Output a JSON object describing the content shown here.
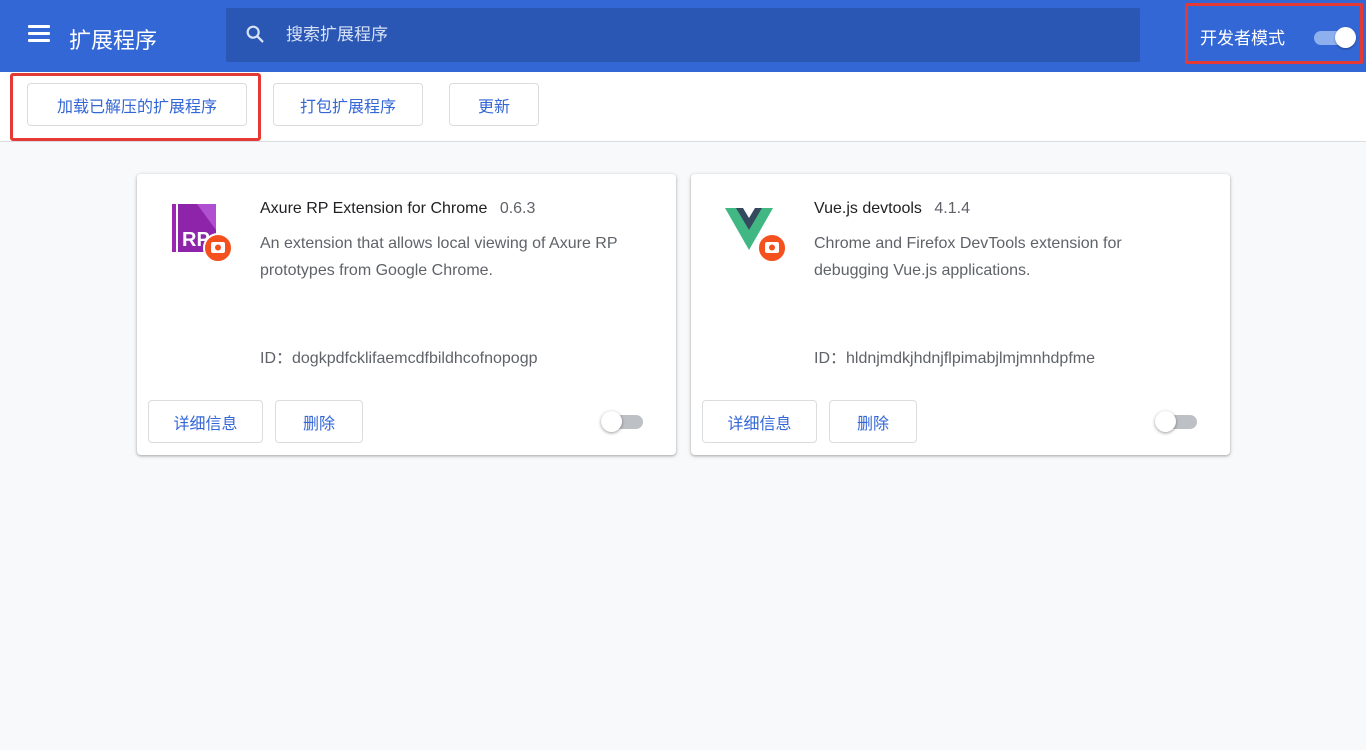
{
  "header": {
    "title": "扩展程序",
    "search_placeholder": "搜索扩展程序",
    "dev_mode_label": "开发者模式",
    "dev_mode_on": true
  },
  "toolbar": {
    "load_unpacked": "加载已解压的扩展程序",
    "pack": "打包扩展程序",
    "update": "更新"
  },
  "extensions": [
    {
      "name": "Axure RP Extension for Chrome",
      "version": "0.6.3",
      "description": "An extension that allows local viewing of Axure RP prototypes from Google Chrome.",
      "id": "ID：dogkpdfcklifaemcdfbildhcofnopogp",
      "details_label": "详细信息",
      "remove_label": "删除",
      "enabled": false,
      "icon": "axure-rp-icon",
      "icon_text": "RP"
    },
    {
      "name": "Vue.js devtools",
      "version": "4.1.4",
      "description": "Chrome and Firefox DevTools extension for debugging Vue.js applications.",
      "id": "ID：hldnjmdkjhdnjflpimabjlmjmnhdpfme",
      "details_label": "详细信息",
      "remove_label": "删除",
      "enabled": false,
      "icon": "vue-devtools-icon"
    }
  ],
  "colors": {
    "header_bg": "#3367d6",
    "search_bg": "#2a56b4",
    "accent": "#3367d6",
    "highlight": "#e53935",
    "badge": "#f4511e"
  }
}
